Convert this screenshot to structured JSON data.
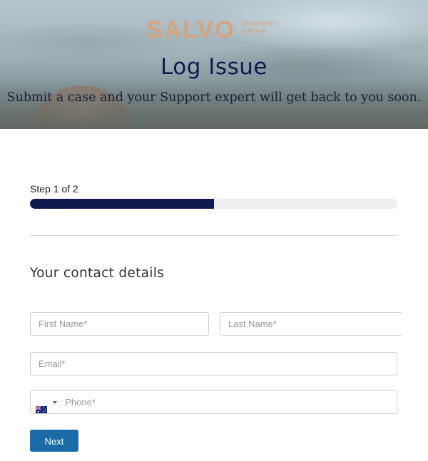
{
  "header": {
    "logo_word": "SALVO",
    "logo_sub": "PROPERTY GROUP",
    "title": "Log Issue",
    "subtitle": "Submit a case and your Support expert will get back to you soon."
  },
  "progress": {
    "label": "Step 1 of 2",
    "fraction": 0.5
  },
  "section": {
    "title": "Your contact details"
  },
  "form": {
    "first_name_placeholder": "First Name*",
    "last_name_placeholder": "Last Name*",
    "email_placeholder": "Email*",
    "phone_placeholder": "Phone*",
    "phone_country_icon": "australia-flag-icon",
    "next_label": "Next"
  },
  "colors": {
    "brand_logo": "#d7a37c",
    "title": "#12194f",
    "progress_fill": "#12194f",
    "progress_track": "#eeeeee",
    "button": "#1a6ba8"
  }
}
